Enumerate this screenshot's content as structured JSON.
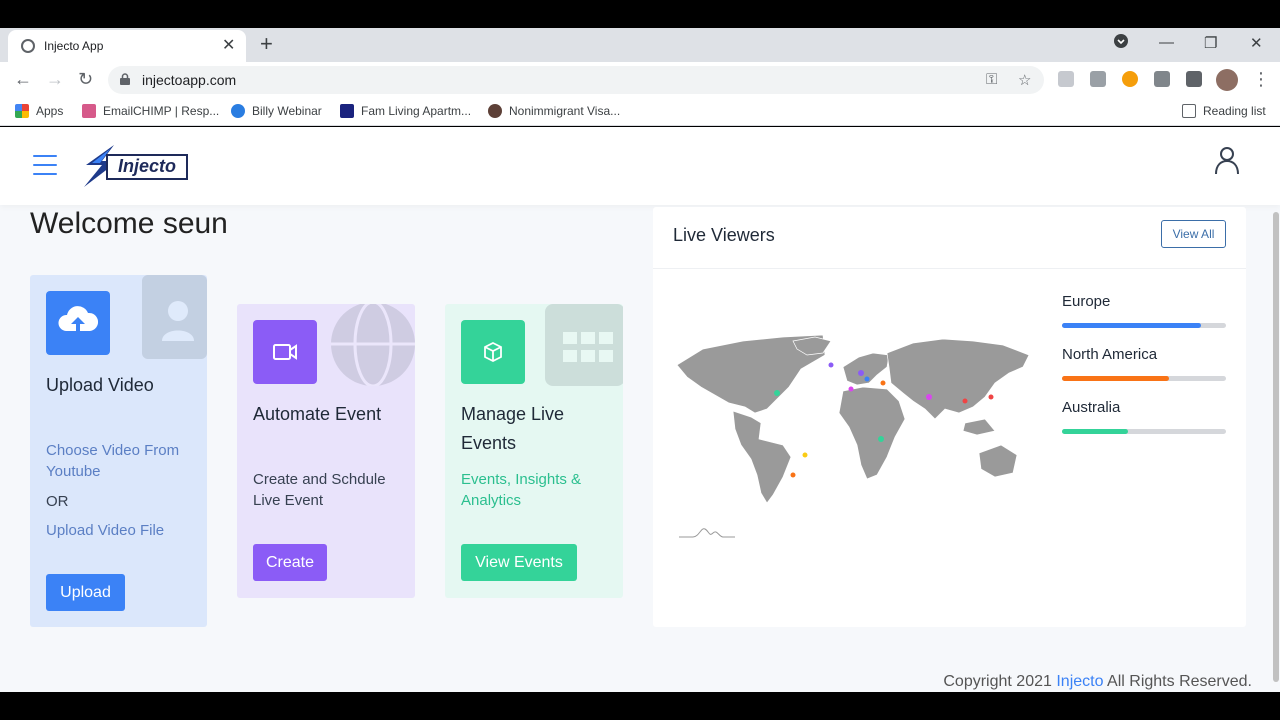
{
  "browser": {
    "tab_title": "Injecto App",
    "url": "injectoapp.com",
    "bookmarks": [
      {
        "label": "Apps",
        "color": "#ea4335"
      },
      {
        "label": "EmailCHIMP | Resp...",
        "color": "#d65a8a"
      },
      {
        "label": "Billy Webinar",
        "color": "#2a7de1"
      },
      {
        "label": "Fam Living Apartm...",
        "color": "#1a237e"
      },
      {
        "label": "Nonimmigrant Visa...",
        "color": "#5d4037"
      }
    ],
    "reading_list": "Reading list"
  },
  "header": {
    "logo_text": "Injecto"
  },
  "welcome": "Welcome seun",
  "cards": [
    {
      "title": "Upload Video",
      "lines": [
        "Choose Video From Youtube",
        "OR",
        "Upload Video File"
      ],
      "button": "Upload",
      "color": "#3b82f6"
    },
    {
      "title": "Automate Event",
      "lines": [
        "Create and Schdule Live Event"
      ],
      "button": "Create",
      "color": "#8b5cf6"
    },
    {
      "title": "Manage Live Events",
      "lines": [
        "Events, Insights & Analytics"
      ],
      "button": "View Events",
      "color": "#34d399"
    }
  ],
  "live_viewers": {
    "title": "Live Viewers",
    "view_all": "View All",
    "regions": [
      {
        "name": "Europe",
        "value": 0.85,
        "color": "#3b82f6"
      },
      {
        "name": "North America",
        "value": 0.65,
        "color": "#f97316"
      },
      {
        "name": "Australia",
        "value": 0.4,
        "color": "#34d399"
      }
    ]
  },
  "footer": {
    "prefix": "Copyright 2021 ",
    "brand": "Injecto",
    "suffix": " All Rights Reserved."
  }
}
